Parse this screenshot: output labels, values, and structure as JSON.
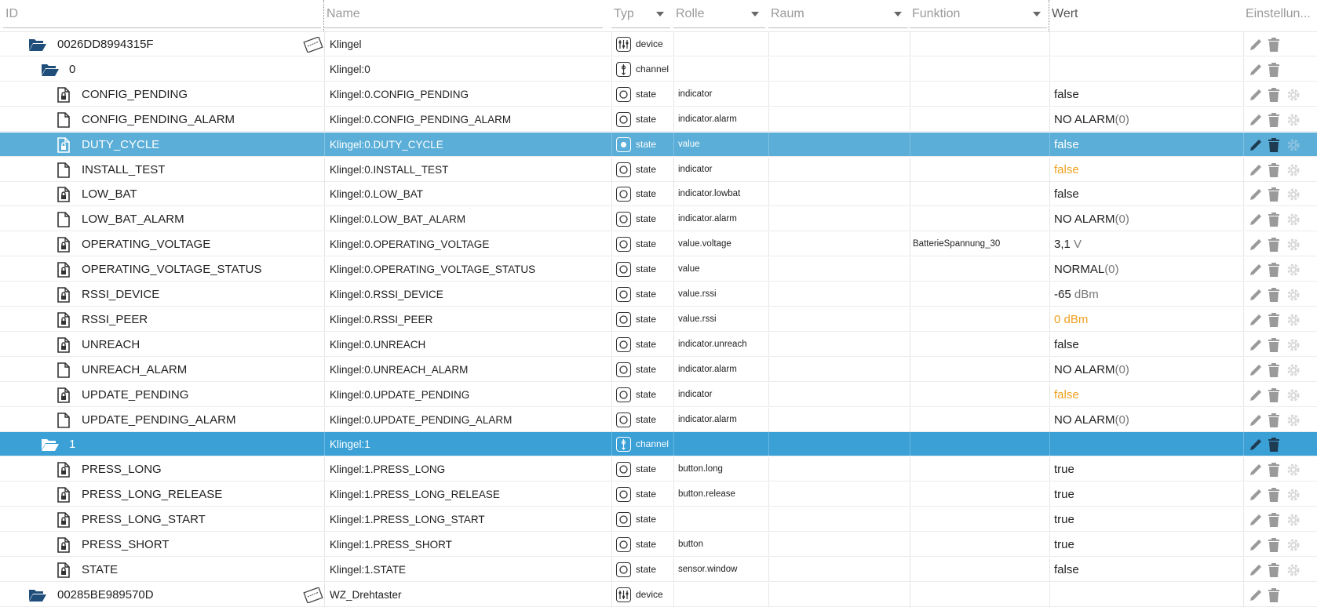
{
  "header": {
    "id": "ID",
    "name": "Name",
    "typ": "Typ",
    "rolle": "Rolle",
    "raum": "Raum",
    "funktion": "Funktion",
    "wert": "Wert",
    "einstellungen": "Einstellun..."
  },
  "rows": [
    {
      "id": "0026DD8994315F",
      "name": "Klingel",
      "type": "device",
      "rolle": "",
      "funktion": "",
      "wert": "",
      "wert_unit": "",
      "icon": "folder-open-icon",
      "level": 0,
      "style": "normal",
      "has_device_img": true
    },
    {
      "id": "0",
      "name": "Klingel:0",
      "type": "channel",
      "rolle": "",
      "funktion": "",
      "wert": "",
      "wert_unit": "",
      "icon": "folder-open-icon",
      "level": 1,
      "style": "normal"
    },
    {
      "id": "CONFIG_PENDING",
      "name": "Klingel:0.CONFIG_PENDING",
      "type": "state",
      "rolle": "indicator",
      "funktion": "",
      "wert": "false",
      "wert_unit": "",
      "icon": "file-lock-icon",
      "level": 2,
      "style": "normal"
    },
    {
      "id": "CONFIG_PENDING_ALARM",
      "name": "Klingel:0.CONFIG_PENDING_ALARM",
      "type": "state",
      "rolle": "indicator.alarm",
      "funktion": "",
      "wert": "NO ALARM",
      "wert_unit": "(0)",
      "icon": "file-icon",
      "level": 2,
      "style": "normal"
    },
    {
      "id": "DUTY_CYCLE",
      "name": "Klingel:0.DUTY_CYCLE",
      "type": "state",
      "rolle": "value",
      "funktion": "",
      "wert": "false",
      "wert_unit": "",
      "icon": "file-lock-icon",
      "level": 2,
      "style": "sel"
    },
    {
      "id": "INSTALL_TEST",
      "name": "Klingel:0.INSTALL_TEST",
      "type": "state",
      "rolle": "indicator",
      "funktion": "",
      "wert": "false",
      "wert_unit": "",
      "icon": "file-icon",
      "level": 2,
      "style": "normal",
      "orange": true
    },
    {
      "id": "LOW_BAT",
      "name": "Klingel:0.LOW_BAT",
      "type": "state",
      "rolle": "indicator.lowbat",
      "funktion": "",
      "wert": "false",
      "wert_unit": "",
      "icon": "file-lock-icon",
      "level": 2,
      "style": "normal"
    },
    {
      "id": "LOW_BAT_ALARM",
      "name": "Klingel:0.LOW_BAT_ALARM",
      "type": "state",
      "rolle": "indicator.alarm",
      "funktion": "",
      "wert": "NO ALARM",
      "wert_unit": "(0)",
      "icon": "file-icon",
      "level": 2,
      "style": "normal"
    },
    {
      "id": "OPERATING_VOLTAGE",
      "name": "Klingel:0.OPERATING_VOLTAGE",
      "type": "state",
      "rolle": "value.voltage",
      "funktion": "BatterieSpannung_30",
      "wert": "3,1",
      "wert_unit": " V",
      "icon": "file-lock-icon",
      "level": 2,
      "style": "normal"
    },
    {
      "id": "OPERATING_VOLTAGE_STATUS",
      "name": "Klingel:0.OPERATING_VOLTAGE_STATUS",
      "type": "state",
      "rolle": "value",
      "funktion": "",
      "wert": "NORMAL",
      "wert_unit": "(0)",
      "icon": "file-lock-icon",
      "level": 2,
      "style": "normal"
    },
    {
      "id": "RSSI_DEVICE",
      "name": "Klingel:0.RSSI_DEVICE",
      "type": "state",
      "rolle": "value.rssi",
      "funktion": "",
      "wert": "-65",
      "wert_unit": " dBm",
      "icon": "file-lock-icon",
      "level": 2,
      "style": "normal"
    },
    {
      "id": "RSSI_PEER",
      "name": "Klingel:0.RSSI_PEER",
      "type": "state",
      "rolle": "value.rssi",
      "funktion": "",
      "wert": "0 dBm",
      "wert_unit": "",
      "icon": "file-lock-icon",
      "level": 2,
      "style": "normal",
      "orange": true
    },
    {
      "id": "UNREACH",
      "name": "Klingel:0.UNREACH",
      "type": "state",
      "rolle": "indicator.unreach",
      "funktion": "",
      "wert": "false",
      "wert_unit": "",
      "icon": "file-lock-icon",
      "level": 2,
      "style": "normal"
    },
    {
      "id": "UNREACH_ALARM",
      "name": "Klingel:0.UNREACH_ALARM",
      "type": "state",
      "rolle": "indicator.alarm",
      "funktion": "",
      "wert": "NO ALARM",
      "wert_unit": "(0)",
      "icon": "file-icon",
      "level": 2,
      "style": "normal"
    },
    {
      "id": "UPDATE_PENDING",
      "name": "Klingel:0.UPDATE_PENDING",
      "type": "state",
      "rolle": "indicator",
      "funktion": "",
      "wert": "false",
      "wert_unit": "",
      "icon": "file-lock-icon",
      "level": 2,
      "style": "normal",
      "orange": true
    },
    {
      "id": "UPDATE_PENDING_ALARM",
      "name": "Klingel:0.UPDATE_PENDING_ALARM",
      "type": "state",
      "rolle": "indicator.alarm",
      "funktion": "",
      "wert": "NO ALARM",
      "wert_unit": "(0)",
      "icon": "file-icon",
      "level": 2,
      "style": "normal"
    },
    {
      "id": "1",
      "name": "Klingel:1",
      "type": "channel",
      "rolle": "",
      "funktion": "",
      "wert": "",
      "wert_unit": "",
      "icon": "folder-open-icon",
      "level": 1,
      "style": "sel2"
    },
    {
      "id": "PRESS_LONG",
      "name": "Klingel:1.PRESS_LONG",
      "type": "state",
      "rolle": "button.long",
      "funktion": "",
      "wert": "true",
      "wert_unit": "",
      "icon": "file-lock-icon",
      "level": 2,
      "style": "normal"
    },
    {
      "id": "PRESS_LONG_RELEASE",
      "name": "Klingel:1.PRESS_LONG_RELEASE",
      "type": "state",
      "rolle": "button.release",
      "funktion": "",
      "wert": "true",
      "wert_unit": "",
      "icon": "file-lock-icon",
      "level": 2,
      "style": "normal"
    },
    {
      "id": "PRESS_LONG_START",
      "name": "Klingel:1.PRESS_LONG_START",
      "type": "state",
      "rolle": "",
      "funktion": "",
      "wert": "true",
      "wert_unit": "",
      "icon": "file-lock-icon",
      "level": 2,
      "style": "normal"
    },
    {
      "id": "PRESS_SHORT",
      "name": "Klingel:1.PRESS_SHORT",
      "type": "state",
      "rolle": "button",
      "funktion": "",
      "wert": "true",
      "wert_unit": "",
      "icon": "file-lock-icon",
      "level": 2,
      "style": "normal"
    },
    {
      "id": "STATE",
      "name": "Klingel:1.STATE",
      "type": "state",
      "rolle": "sensor.window",
      "funktion": "",
      "wert": "false",
      "wert_unit": "",
      "icon": "file-lock-icon",
      "level": 2,
      "style": "normal"
    },
    {
      "id": "00285BE989570D",
      "name": "WZ_Drehtaster",
      "type": "device",
      "rolle": "",
      "funktion": "",
      "wert": "",
      "wert_unit": "",
      "icon": "folder-open-icon",
      "level": 0,
      "style": "normal",
      "has_device_img": true
    }
  ],
  "colors": {
    "selected_row": "#5aaed7",
    "selected_channel_row": "#3aa0d6",
    "folder": "#1f4e7a",
    "orange_value": "#f0a020"
  }
}
